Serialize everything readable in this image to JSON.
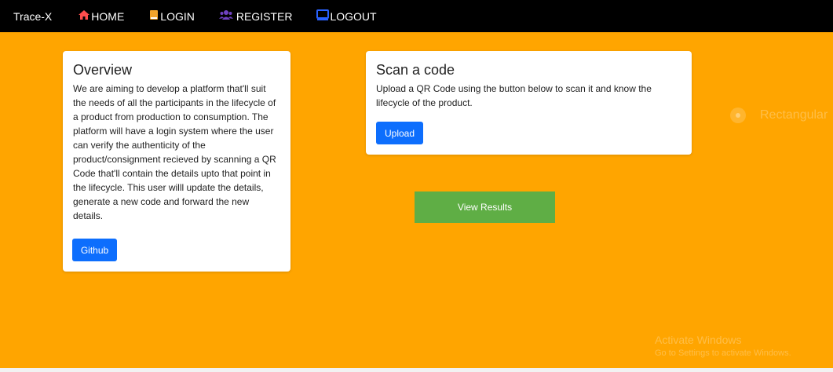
{
  "navbar": {
    "brand": "Trace-X",
    "links": [
      {
        "label": "HOME",
        "icon": "home-icon",
        "icon_color": "#ff4d4d"
      },
      {
        "label": "LOGIN",
        "icon": "book-icon",
        "icon_color": "#f4a52b"
      },
      {
        "label": "REGISTER",
        "icon": "users-icon",
        "icon_color": "#6f42c1"
      },
      {
        "label": "LOGOUT",
        "icon": "monitor-icon",
        "icon_color": "#2962ff"
      }
    ]
  },
  "overview": {
    "title": "Overview",
    "text": "We are aiming to develop a platform that'll suit the needs of all the participants in the lifecycle of a product from production to consumption. The platform will have a login system where the user can verify the authenticity of the product/consignment recieved by scanning a QR Code that'll contain the details upto that point in the lifecycle. This user willl update the details, generate a new code and forward the new details.",
    "button": "Github"
  },
  "scan": {
    "title": "Scan a code",
    "text": "Upload a QR Code using the button below to scan it and know the lifecycle of the product.",
    "button": "Upload"
  },
  "view_results": "View Results",
  "overlay": {
    "rect_label": "Rectangular",
    "activate_title": "Activate Windows",
    "activate_sub": "Go to Settings to activate Windows."
  },
  "colors": {
    "background": "#ffa500",
    "navbar": "#000000",
    "primary_button": "#0d6efd",
    "view_results": "#5fae45"
  }
}
